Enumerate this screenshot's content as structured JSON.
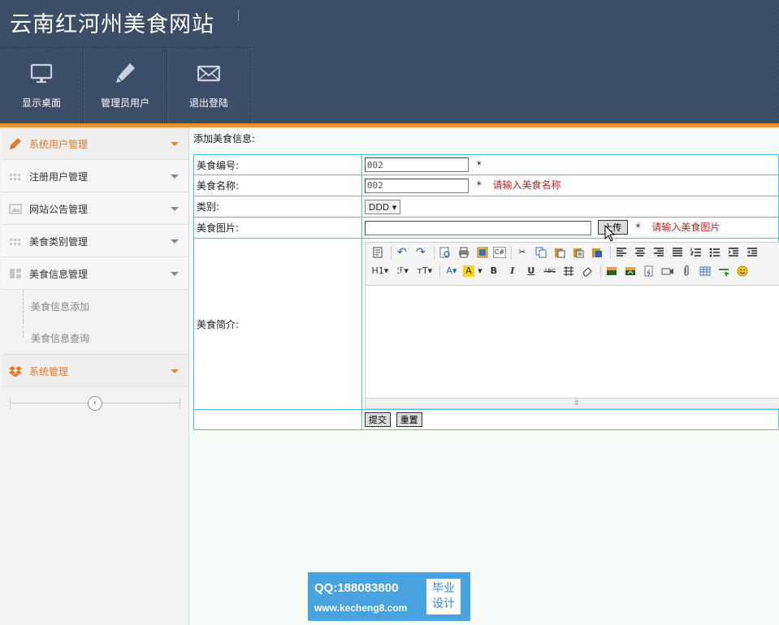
{
  "header": {
    "title": "云南红河州美食网站",
    "nav": [
      {
        "label": "显示桌面",
        "icon": "monitor-icon"
      },
      {
        "label": "管理员用户",
        "icon": "pencil-icon"
      },
      {
        "label": "退出登陆",
        "icon": "mail-icon"
      }
    ]
  },
  "colors": {
    "header_bg": "#3a4d66",
    "accent": "#e8932f",
    "table_border": "#4cc0e0",
    "error_text": "#c41f1f"
  },
  "sidebar": {
    "items": [
      {
        "label": "系统用户管理",
        "icon": "pencil-icon",
        "active": true
      },
      {
        "label": "注册用户管理",
        "icon": "grid-icon"
      },
      {
        "label": "网站公告管理",
        "icon": "image-icon"
      },
      {
        "label": "美食类别管理",
        "icon": "grid-icon"
      },
      {
        "label": "美食信息管理",
        "icon": "layout-icon"
      }
    ],
    "sub_items": [
      {
        "label": "美食信息添加"
      },
      {
        "label": "美食信息查询"
      }
    ],
    "system": {
      "label": "系统管理",
      "icon": "dropbox-icon"
    },
    "collapse_icon": "chevron-left-icon"
  },
  "form": {
    "title": "添加美食信息:",
    "rows": {
      "code": {
        "label": "美食编号:",
        "value": "002",
        "required": "*"
      },
      "name": {
        "label": "美食名称:",
        "value": "002",
        "required": "*",
        "error": "请输入美食名称"
      },
      "category": {
        "label": "类别:",
        "value": "DDD"
      },
      "image": {
        "label": "美食图片:",
        "value": "",
        "upload_label": "上传",
        "required": "*",
        "error": "请输入美食图片"
      },
      "intro": {
        "label": "美食简介:"
      }
    },
    "submit_label": "提交",
    "reset_label": "重置"
  },
  "editor": {
    "toolbar_row1": [
      "source-icon",
      "undo-icon",
      "redo-icon",
      "preview-icon",
      "print-icon",
      "template-icon",
      "code-icon",
      "cut-icon",
      "copy-icon",
      "paste-icon",
      "paste-text-icon",
      "paste-word-icon",
      "align-left-icon",
      "align-center-icon",
      "align-right-icon",
      "justify-icon",
      "ordered-list-icon",
      "unordered-list-icon",
      "indent-icon",
      "outdent-icon"
    ],
    "toolbar_row2": [
      "heading-icon",
      "font-family-icon",
      "font-size-icon",
      "font-color-icon",
      "highlight-icon",
      "bold-icon",
      "italic-icon",
      "underline-icon",
      "strikethrough-icon",
      "line-height-icon",
      "eraser-icon",
      "image-icon",
      "multi-image-icon",
      "flash-icon",
      "media-icon",
      "attachment-icon",
      "table-icon",
      "hr-icon",
      "emoticon-icon"
    ],
    "row2_text": {
      "heading": "H1",
      "bold": "B",
      "italic": "I",
      "underline": "U",
      "strike": "ABC"
    }
  },
  "watermark": {
    "qq": "QQ:188083800",
    "url": "www.kecheng8.com",
    "badge_line1": "毕业",
    "badge_line2": "设计"
  }
}
